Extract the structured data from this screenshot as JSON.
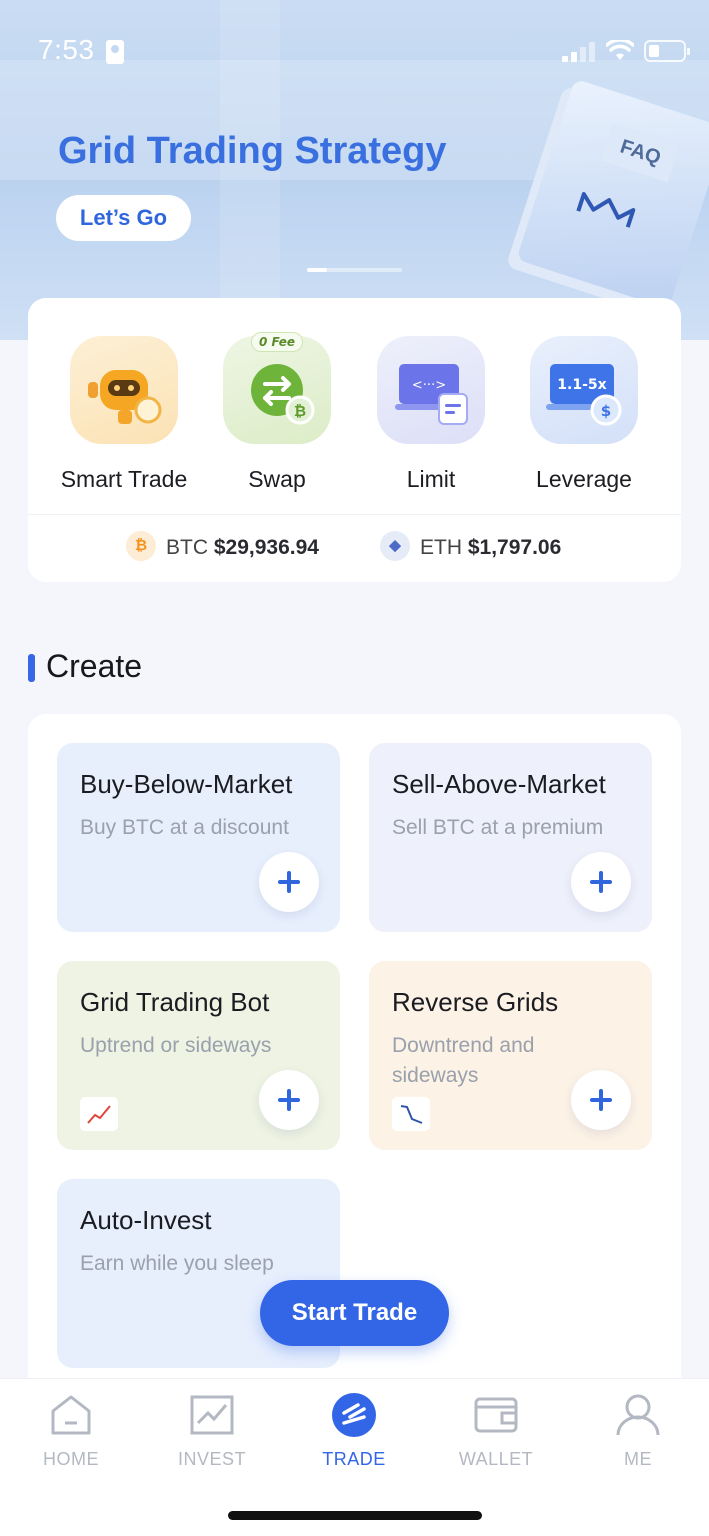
{
  "status_bar": {
    "time": "7:53"
  },
  "banner": {
    "title": "Grid Trading Strategy",
    "button": "Let’s Go",
    "book_tag": "FAQ"
  },
  "quick_actions": [
    {
      "label": "Smart Trade",
      "icon": "robot-icon"
    },
    {
      "label": "Swap",
      "icon": "swap-icon",
      "badge": "0 Fee"
    },
    {
      "label": "Limit",
      "icon": "limit-order-icon"
    },
    {
      "label": "Leverage",
      "icon": "leverage-icon",
      "tile_text": "1.1-5x"
    }
  ],
  "prices": [
    {
      "symbol": "BTC",
      "value": "$29,936.94",
      "coin_glyph": "₿",
      "color": "#f7931a"
    },
    {
      "symbol": "ETH",
      "value": "$1,797.06",
      "coin_glyph": "◆",
      "color": "#4e6cc7"
    }
  ],
  "create": {
    "title": "Create",
    "cards": [
      {
        "title": "Buy-Below-Market",
        "subtitle": "Buy BTC at a discount"
      },
      {
        "title": "Sell-Above-Market",
        "subtitle": "Sell BTC at a premium"
      },
      {
        "title": "Grid Trading Bot",
        "subtitle": "Uptrend or sideways"
      },
      {
        "title": "Reverse Grids",
        "subtitle": "Downtrend and sideways"
      },
      {
        "title": "Auto-Invest",
        "subtitle": "Earn while you sleep"
      }
    ],
    "start_button": "Start Trade"
  },
  "tabs": [
    {
      "label": "HOME"
    },
    {
      "label": "INVEST"
    },
    {
      "label": "TRADE",
      "active": true
    },
    {
      "label": "WALLET"
    },
    {
      "label": "ME"
    }
  ],
  "colors": {
    "accent": "#3366e6",
    "banner_title": "#3a6fe0"
  }
}
